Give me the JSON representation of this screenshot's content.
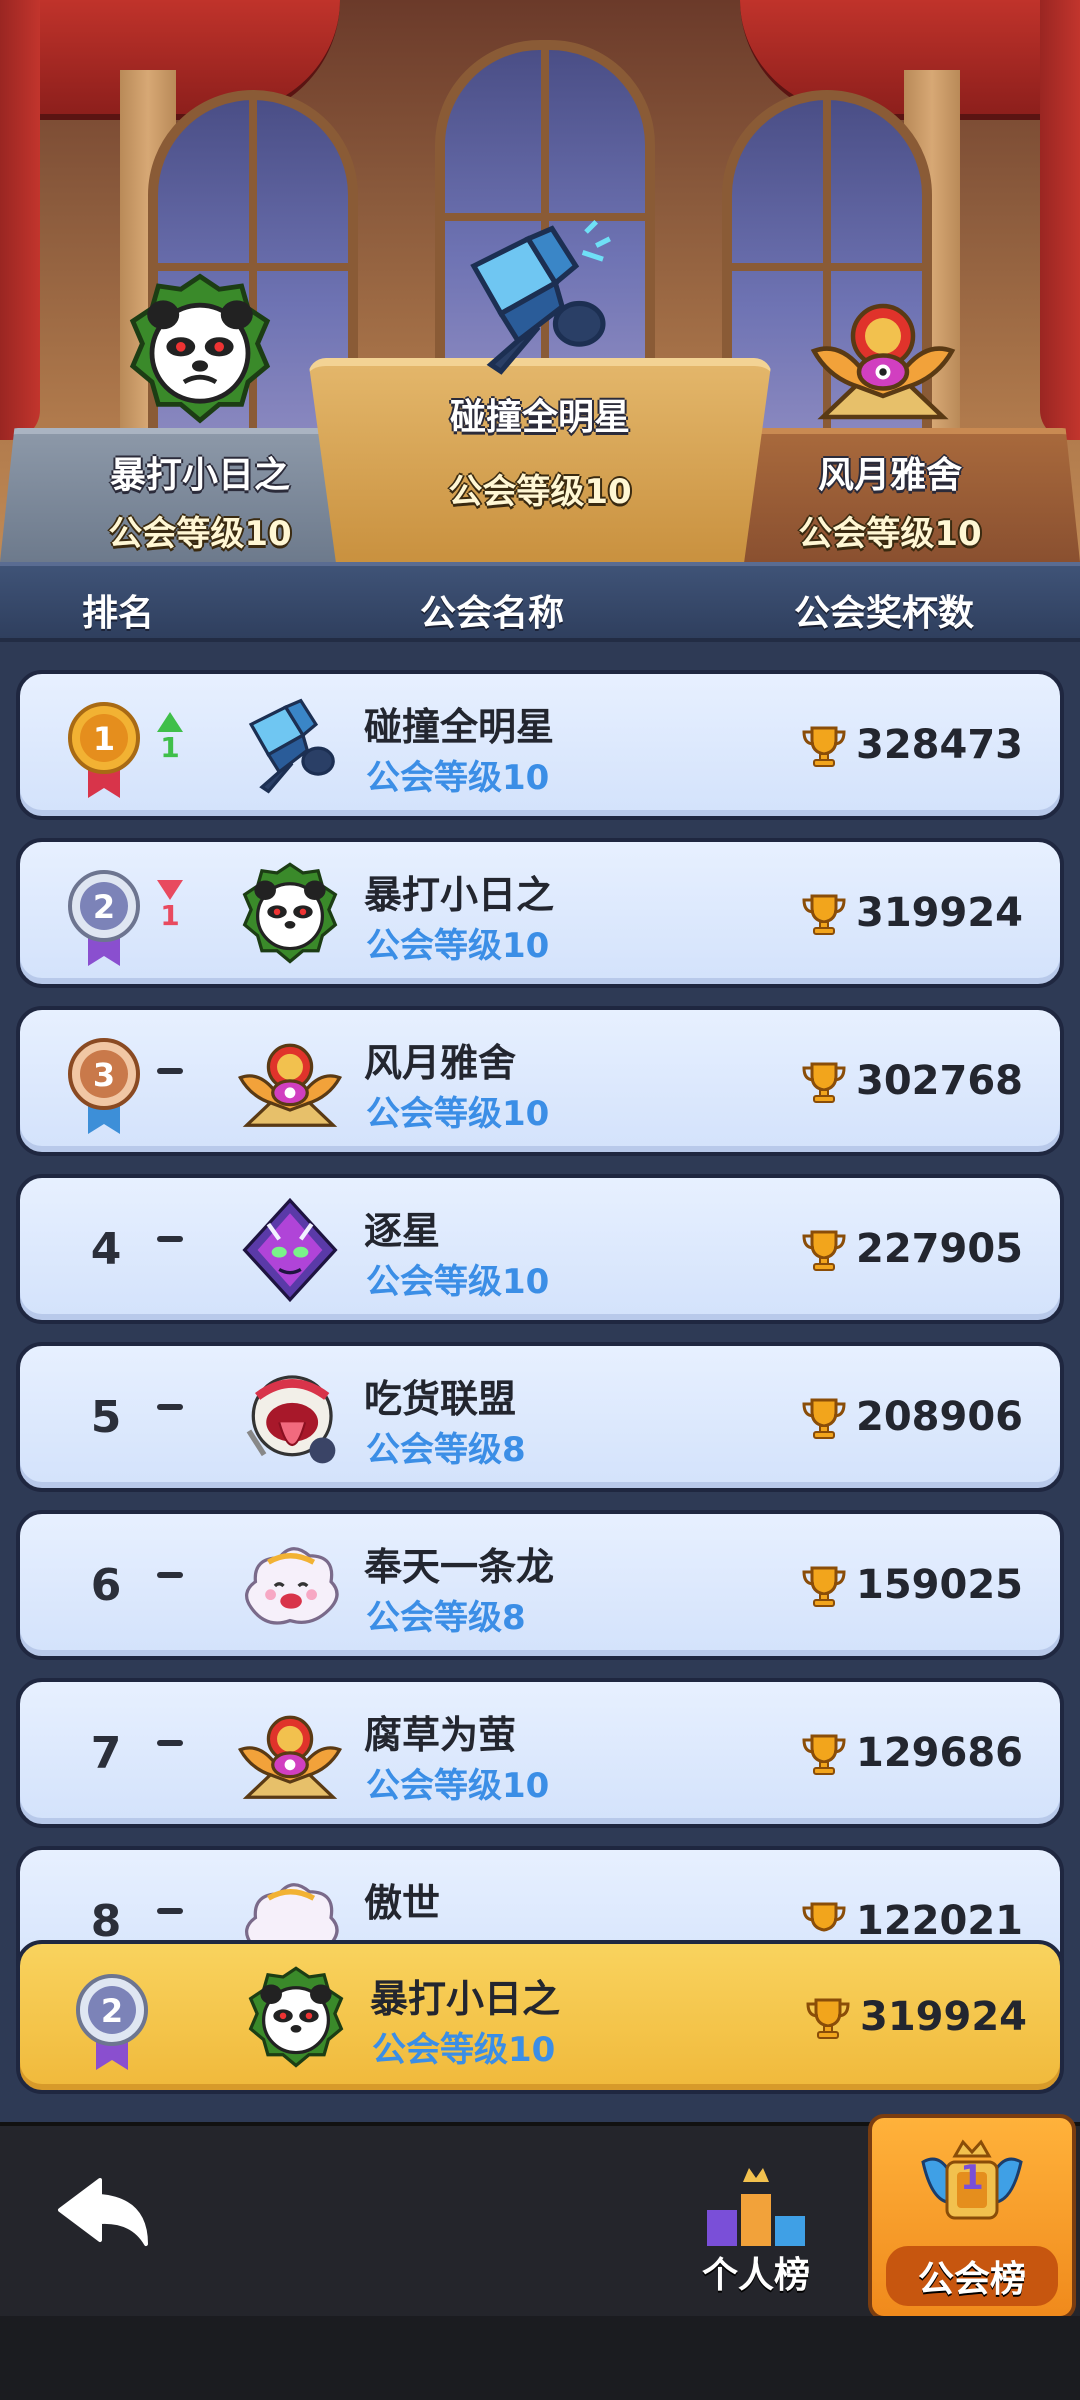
{
  "podium": {
    "first": {
      "name": "碰撞全明星",
      "level": "公会等级10",
      "emblem": "crystal-hammer-emblem"
    },
    "second": {
      "name": "暴打小日之",
      "level": "公会等级10",
      "emblem": "panda-emblem"
    },
    "third": {
      "name": "风月雅舍",
      "level": "公会等级10",
      "emblem": "golden-scarab-emblem"
    }
  },
  "columns": {
    "rank": "排名",
    "guild_name": "公会名称",
    "trophies": "公会奖杯数"
  },
  "rows": [
    {
      "rank": "1",
      "change": "up",
      "change_value": "1",
      "name": "碰撞全明星",
      "level": "公会等级10",
      "trophies": "328473",
      "emblem": "crystal-hammer-emblem",
      "medal": "gold"
    },
    {
      "rank": "2",
      "change": "down",
      "change_value": "1",
      "name": "暴打小日之",
      "level": "公会等级10",
      "trophies": "319924",
      "emblem": "panda-emblem",
      "medal": "silver"
    },
    {
      "rank": "3",
      "change": "none",
      "change_value": "",
      "name": "风月雅舍",
      "level": "公会等级10",
      "trophies": "302768",
      "emblem": "golden-scarab-emblem",
      "medal": "bronze"
    },
    {
      "rank": "4",
      "change": "none",
      "change_value": "",
      "name": "逐星",
      "level": "公会等级10",
      "trophies": "227905",
      "emblem": "purple-dragon-emblem"
    },
    {
      "rank": "5",
      "change": "none",
      "change_value": "",
      "name": "吃货联盟",
      "level": "公会等级8",
      "trophies": "208906",
      "emblem": "tongue-monster-emblem"
    },
    {
      "rank": "6",
      "change": "none",
      "change_value": "",
      "name": "奉天一条龙",
      "level": "公会等级8",
      "trophies": "159025",
      "emblem": "cloud-character-emblem"
    },
    {
      "rank": "7",
      "change": "none",
      "change_value": "",
      "name": "腐草为萤",
      "level": "公会等级10",
      "trophies": "129686",
      "emblem": "golden-scarab-emblem"
    },
    {
      "rank": "8",
      "change": "none",
      "change_value": "",
      "name": "傲世",
      "level": "",
      "trophies": "122021",
      "emblem": "cloud-character-emblem"
    }
  ],
  "my_guild": {
    "rank": "2",
    "name": "暴打小日之",
    "level": "公会等级10",
    "trophies": "319924",
    "emblem": "panda-emblem",
    "medal": "silver"
  },
  "bottom_bar": {
    "back": "back-arrow-icon",
    "personal_tab": "个人榜",
    "guild_tab": "公会榜",
    "guild_tab_badge": "1"
  },
  "colors": {
    "gold_medal": "#f2b233",
    "silver_medal": "#7c83b8",
    "bronze_medal": "#c9794a",
    "level_text": "#3b8ee6",
    "my_row": "#f4c54a",
    "active_tab": "#f5a12a"
  }
}
